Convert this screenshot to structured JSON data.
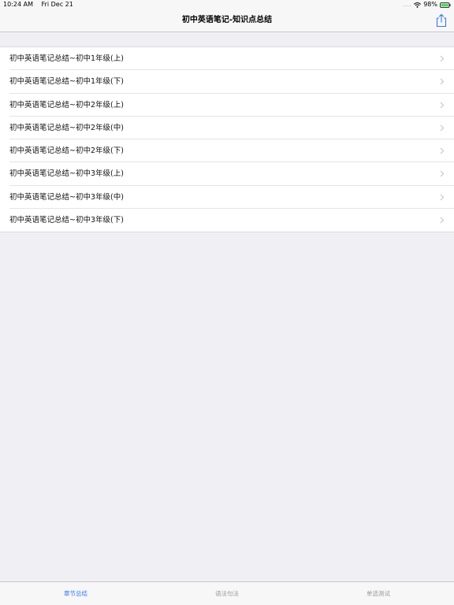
{
  "status_bar": {
    "time": "10:24 AM",
    "date": "Fri Dec 21",
    "signal": "....",
    "battery": "98%"
  },
  "nav": {
    "title": "初中英语笔记-知识点总结",
    "share_icon": "share-icon"
  },
  "list": {
    "items": [
      {
        "label": "初中英语笔记总结~初中1年级(上)"
      },
      {
        "label": "初中英语笔记总结~初中1年级(下)"
      },
      {
        "label": "初中英语笔记总结~初中2年级(上)"
      },
      {
        "label": "初中英语笔记总结~初中2年级(中)"
      },
      {
        "label": "初中英语笔记总结~初中2年级(下)"
      },
      {
        "label": "初中英语笔记总结~初中3年级(上)"
      },
      {
        "label": "初中英语笔记总结~初中3年级(中)"
      },
      {
        "label": "初中英语笔记总结~初中3年级(下)"
      }
    ]
  },
  "tabs": [
    {
      "label": "章节总结",
      "active": true
    },
    {
      "label": "语法句法",
      "active": false
    },
    {
      "label": "单选测试",
      "active": false
    }
  ],
  "colors": {
    "accent": "#3478f6",
    "background": "#efeff4",
    "battery_green": "#4cd964"
  }
}
